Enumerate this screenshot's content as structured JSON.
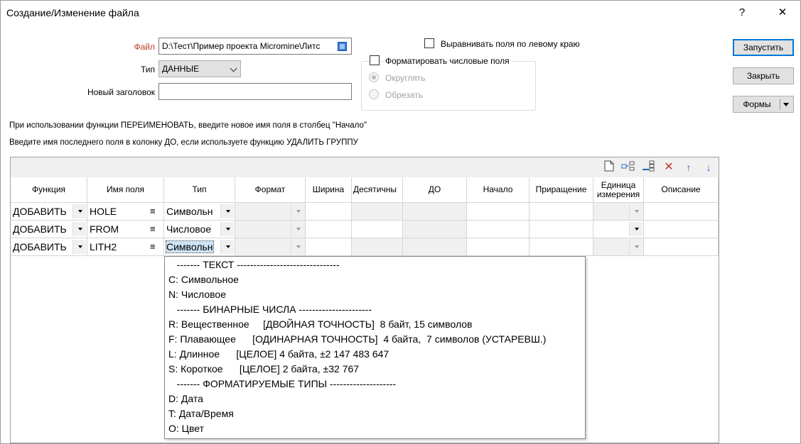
{
  "window": {
    "title": "Создание/Изменение файла",
    "help": "?",
    "close": "✕"
  },
  "form": {
    "file_label": "Файл",
    "file_value": "D:\\Тест\\Пример проекта Micromine\\Литс",
    "type_label": "Тип",
    "type_value": "ДАННЫЕ",
    "header_label": "Новый заголовок",
    "header_value": ""
  },
  "options": {
    "align_left": "Выравнивать поля по левому краю",
    "format_numeric": "Форматировать числовые поля",
    "round": "Округлять",
    "truncate": "Обрезать"
  },
  "buttons": {
    "run": "Запустить",
    "close": "Закрыть",
    "forms": "Формы"
  },
  "hints": {
    "rename": "При использовании функции ПЕРЕИМЕНОВАТЬ, введите новое имя поля в столбец \"Начало\"",
    "delete_group": "Введите имя последнего поля в колонку ДО, если используете функцию УДАЛИТЬ ГРУППУ"
  },
  "columns": [
    "Функция",
    "Имя поля",
    "Тип",
    "Формат",
    "Ширина",
    "Десятичны",
    "ДО",
    "Начало",
    "Приращение",
    "Единица измерения",
    "Описание"
  ],
  "rows": [
    {
      "func": "ДОБАВИТЬ",
      "name": "HOLE",
      "type": "Символьн"
    },
    {
      "func": "ДОБАВИТЬ",
      "name": "FROM",
      "type": "Числовое"
    },
    {
      "func": "ДОБАВИТЬ",
      "name": "LITH2",
      "type": "Символьн"
    }
  ],
  "dropdown_options": [
    "   ------- ТЕКСТ -------------------------------",
    "C: Символьное",
    "N: Числовое",
    "   ------- БИНАРНЫЕ ЧИСЛА ----------------------",
    "R: Вещественное     [ДВОЙНАЯ ТОЧНОСТЬ]  8 байт, 15 символов",
    "F: Плавающее      [ОДИНАРНАЯ ТОЧНОСТЬ]  4 байта,  7 символов (УСТАРЕВШ.)",
    "L: Длинное      [ЦЕЛОЕ] 4 байта, ±2 147 483 647",
    "S: Короткое      [ЦЕЛОЕ] 2 байта, ±32 767",
    "   ------- ФОРМАТИРУЕМЫЕ ТИПЫ --------------------",
    "D: Дата",
    "T: Дата/Время",
    "O: Цвет"
  ],
  "colors": {
    "file_label": "#c0392b",
    "accent": "#0078d7",
    "selected": "#cce4f7"
  }
}
